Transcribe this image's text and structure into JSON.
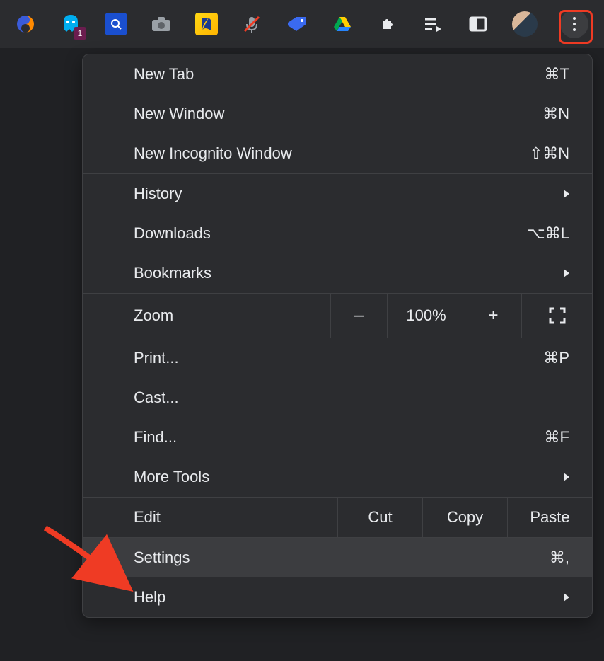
{
  "toolbar": {
    "badge": "1"
  },
  "menu": {
    "new_tab": {
      "label": "New Tab",
      "shortcut": "⌘T"
    },
    "new_window": {
      "label": "New Window",
      "shortcut": "⌘N"
    },
    "new_incognito": {
      "label": "New Incognito Window",
      "shortcut": "⇧⌘N"
    },
    "history": {
      "label": "History"
    },
    "downloads": {
      "label": "Downloads",
      "shortcut": "⌥⌘L"
    },
    "bookmarks": {
      "label": "Bookmarks"
    },
    "zoom": {
      "label": "Zoom",
      "value": "100%",
      "minus": "–",
      "plus": "+"
    },
    "print": {
      "label": "Print...",
      "shortcut": "⌘P"
    },
    "cast": {
      "label": "Cast..."
    },
    "find": {
      "label": "Find...",
      "shortcut": "⌘F"
    },
    "more_tools": {
      "label": "More Tools"
    },
    "edit": {
      "label": "Edit",
      "cut": "Cut",
      "copy": "Copy",
      "paste": "Paste"
    },
    "settings": {
      "label": "Settings",
      "shortcut": "⌘,"
    },
    "help": {
      "label": "Help"
    }
  }
}
